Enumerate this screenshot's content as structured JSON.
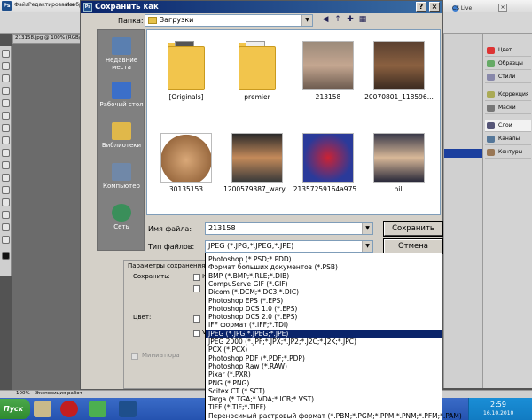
{
  "photoshop": {
    "menu": [
      "Файл",
      "Редактирование",
      "Изобр"
    ],
    "doc_tab": "213158.jpg @ 100% (RGB/",
    "options_label": "Растушев",
    "cs_live": "CS Live",
    "panels": [
      "Цвет",
      "Образцы",
      "Стили",
      "Коррекция",
      "Маски",
      "Слои",
      "Каналы",
      "Контуры"
    ],
    "status_zoom": "100%",
    "status_text": "Экспозиция работ"
  },
  "dialog": {
    "title": "Сохранить как",
    "folder_label": "Папка:",
    "folder_value": "Загрузки",
    "places": [
      "Недавние места",
      "Рабочий стол",
      "Библиотеки",
      "Компьютер",
      "Сеть"
    ],
    "files": [
      {
        "name": "[Originals]",
        "kind": "folder"
      },
      {
        "name": "premier",
        "kind": "folder"
      },
      {
        "name": "213158",
        "kind": "image"
      },
      {
        "name": "20070801_118596...",
        "kind": "image"
      },
      {
        "name": "30135153",
        "kind": "image"
      },
      {
        "name": "1200579387_wary...",
        "kind": "image"
      },
      {
        "name": "21357259164a975...",
        "kind": "image"
      },
      {
        "name": "bill",
        "kind": "image"
      }
    ],
    "filename_label": "Имя файла:",
    "filename_value": "213158",
    "filetype_label": "Тип файлов:",
    "filetype_value": "JPEG (*.JPG;*.JPEG;*.JPE)",
    "save_button": "Сохранить",
    "cancel_button": "Отмена",
    "params_title": "Параметры сохранения",
    "save_label": "Сохранить:",
    "color_label": "Цвет:",
    "thumbnail_label": "Миниатюра",
    "options_fragment_1": "Ка",
    "options_fragment_2": "V",
    "filetype_options": [
      "Photoshop (*.PSD;*.PDD)",
      "Формат больших документов (*.PSB)",
      "BMP (*.BMP;*.RLE;*.DIB)",
      "CompuServe GIF (*.GIF)",
      "Dicom (*.DCM;*.DC3;*.DIC)",
      "Photoshop EPS (*.EPS)",
      "Photoshop DCS 1.0 (*.EPS)",
      "Photoshop DCS 2.0 (*.EPS)",
      "IFF формат (*.IFF;*.TDI)",
      "JPEG (*.JPG;*.JPEG;*.JPE)",
      "JPEG 2000 (*.JPF;*.JPX;*.JP2;*.J2C;*.J2K;*.JPC)",
      "PCX (*.PCX)",
      "Photoshop PDF (*.PDF;*.PDP)",
      "Photoshop Raw (*.RAW)",
      "Pixar (*.PXR)",
      "PNG (*.PNG)",
      "Scitex CT (*.SCT)",
      "Targa (*.TGA;*.VDA;*.ICB;*.VST)",
      "TIFF (*.TIF;*.TIFF)",
      "Переносимый растровый формат (*.PBM;*.PGM;*.PPM;*.PNM;*.PFM;*.PAM)"
    ],
    "selected_index": 9
  },
  "taskbar": {
    "start": "Пуск",
    "time": "2:59",
    "date": "16.10.2010"
  },
  "colors": {
    "title_start": "#0a246a",
    "title_end": "#3a6ea5",
    "selection": "#0a246a",
    "dialog_bg": "#d4d0c8",
    "taskbar": "#2553b0"
  }
}
